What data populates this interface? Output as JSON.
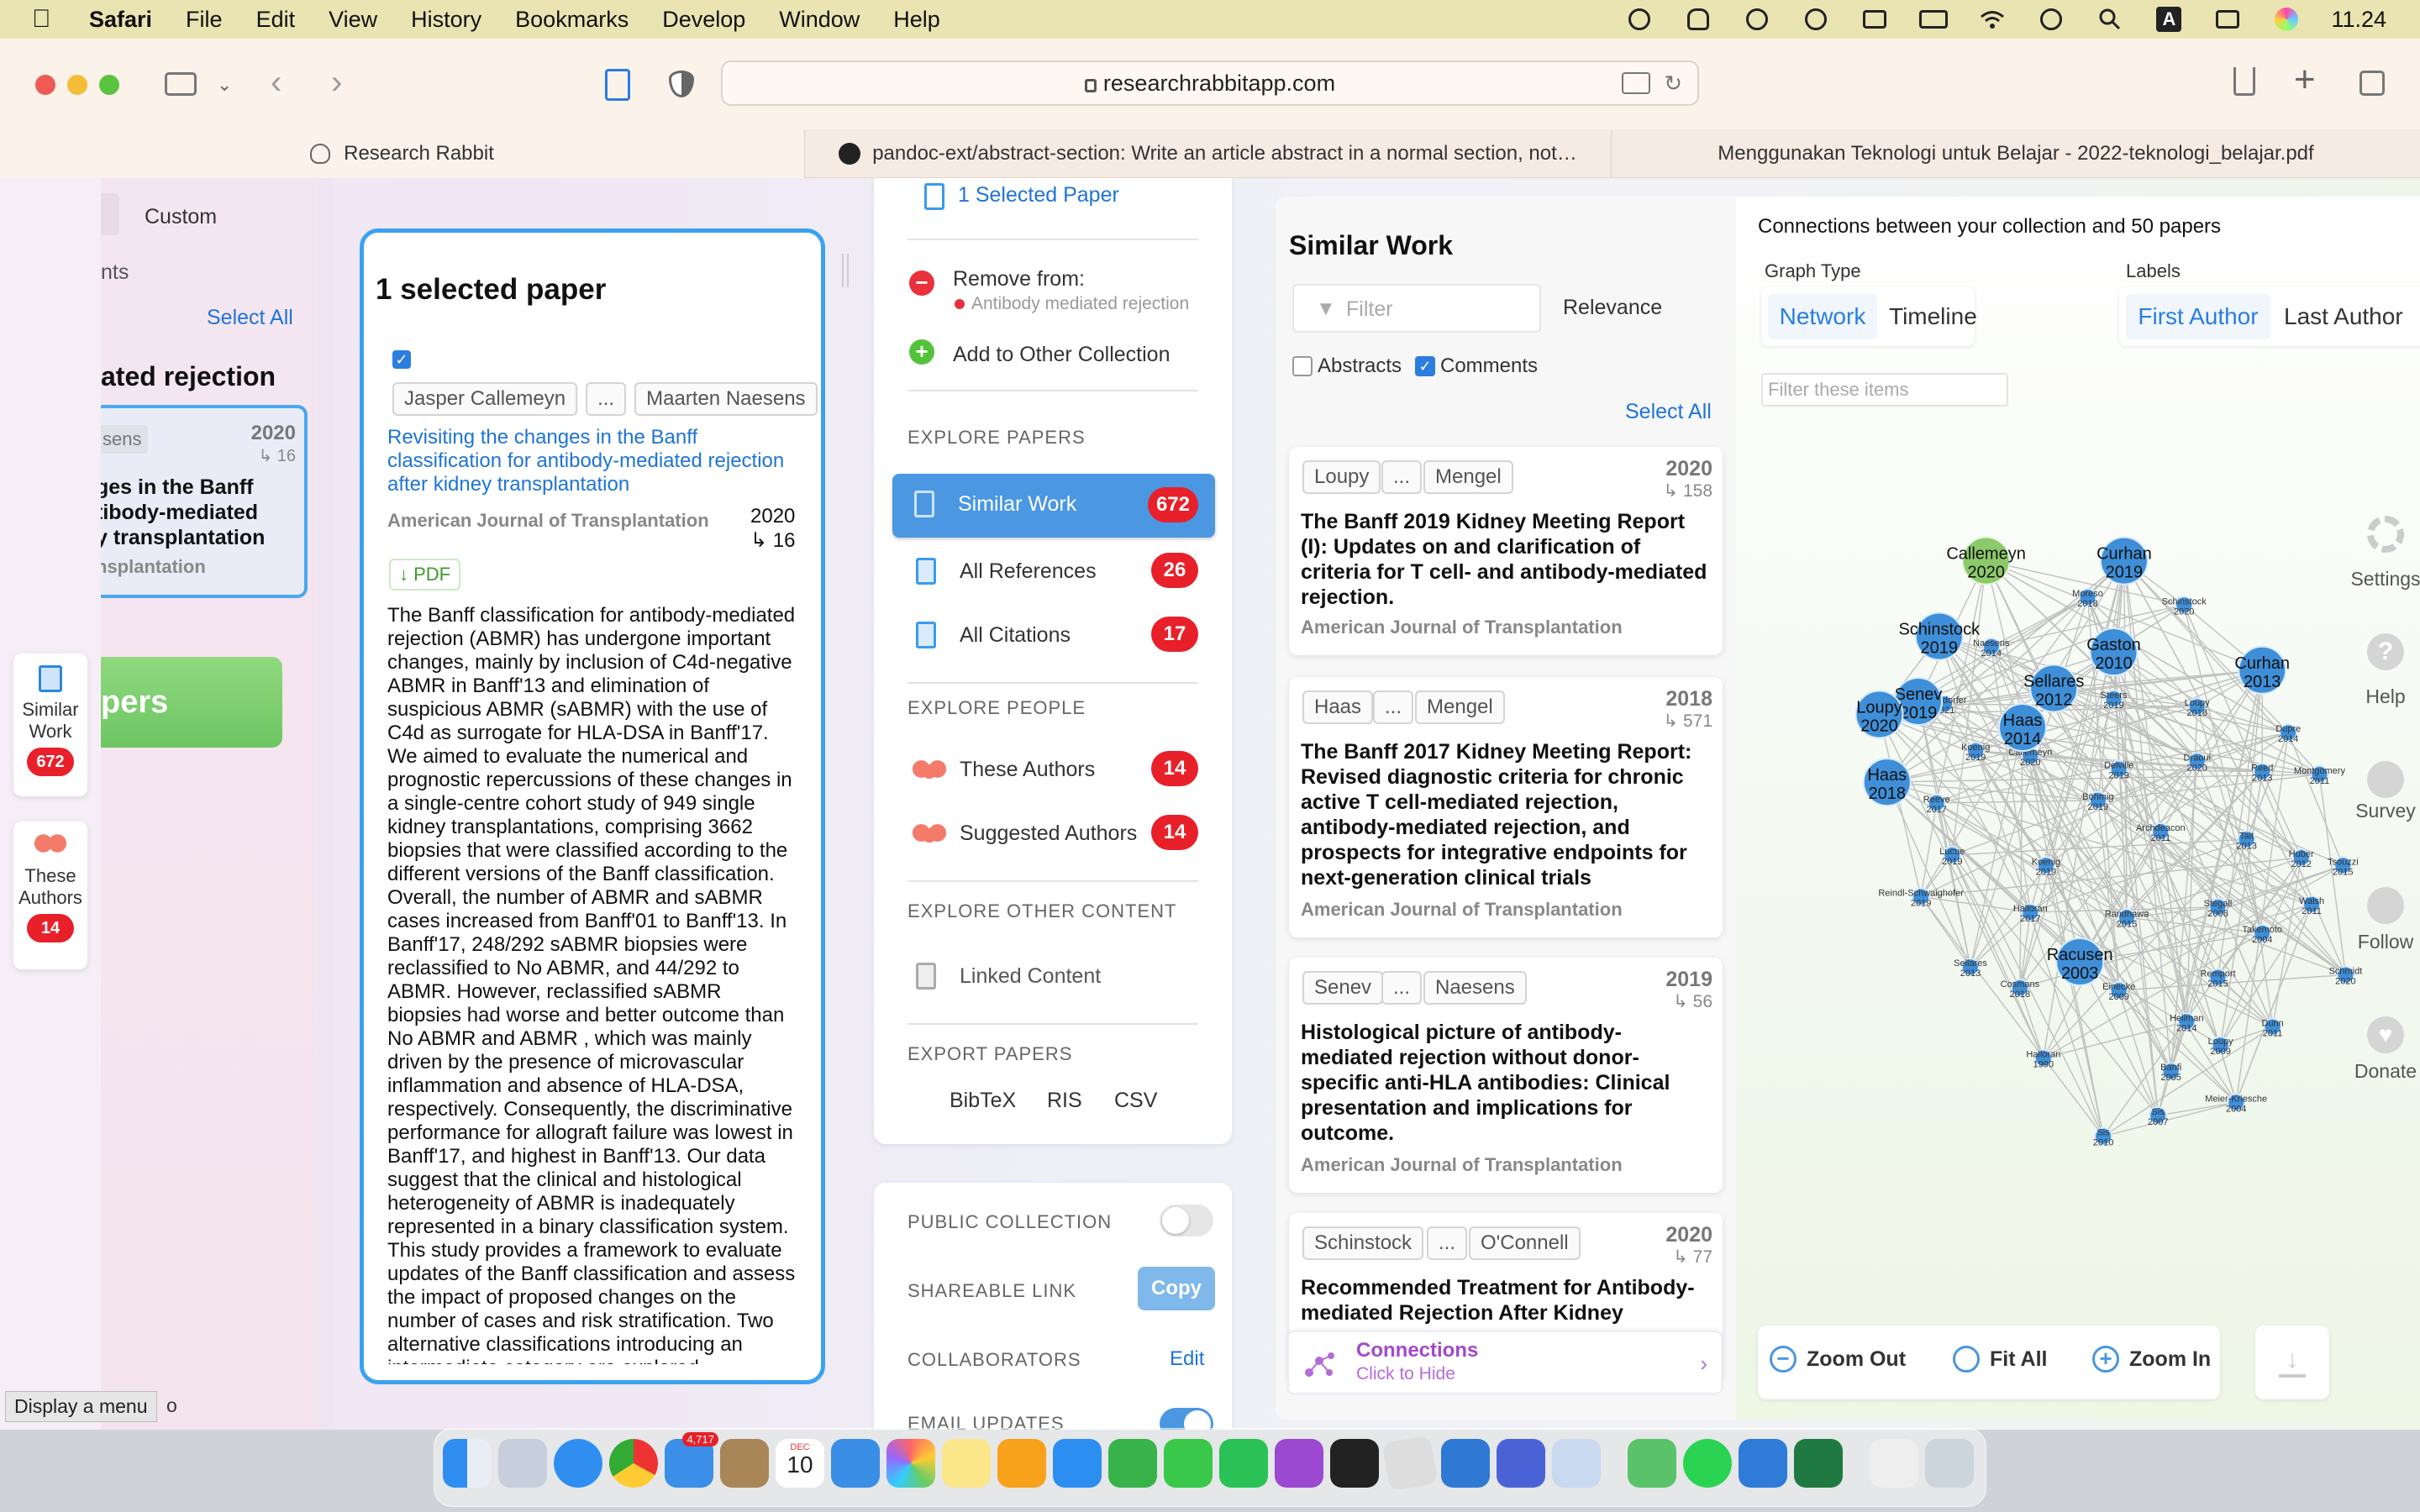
{
  "menubar": {
    "app_name": "Safari",
    "items": [
      "File",
      "Edit",
      "View",
      "History",
      "Bookmarks",
      "Develop",
      "Window",
      "Help"
    ],
    "clock": "11.24",
    "input_source": "A"
  },
  "browser": {
    "url": "researchrabbitapp.com",
    "tabs": [
      {
        "label": "Research Rabbit"
      },
      {
        "label": "pandoc-ext/abstract-section: Write an article abstract in a normal section, not…"
      },
      {
        "label": "Menggunakan Teknologi untuk Belajar - 2022-teknologi_belajar.pdf"
      }
    ]
  },
  "left_panel": {
    "custom_label": "Custom",
    "partial_text": "nts",
    "select_all": "Select All",
    "collection_title": "ated rejection",
    "paper_author": "sens",
    "paper_year": "2020",
    "paper_cites": "↳ 16",
    "paper_title_l1": "ges in the Banff",
    "paper_title_l2": "tibody-mediated",
    "paper_title_l3": "y transplantation",
    "paper_journal": "nsplantation",
    "green_button": "pers",
    "tooltip": "Display a menu",
    "tooltip_tail": "o"
  },
  "side_tabs": [
    {
      "label_1": "Similar",
      "label_2": "Work",
      "count": "672"
    },
    {
      "label_1": "These",
      "label_2": "Authors",
      "count": "14"
    }
  ],
  "selected_paper": {
    "heading": "1 selected paper",
    "author_1": "Jasper Callemeyn",
    "ellipsis": "...",
    "author_2": "Maarten Naesens",
    "title": "Revisiting the changes in the Banff classification for antibody-mediated rejection after kidney transplantation",
    "journal": "American Journal of Transplantation",
    "year": "2020",
    "citations": "↳ 16",
    "pdf": "↓ PDF",
    "abstract": "The Banff classification for antibody-mediated rejection (ABMR) has undergone important changes, mainly by inclusion of C4d-negative ABMR in Banff'13 and elimination of suspicious ABMR (sABMR) with the use of C4d as surrogate for HLA-DSA in Banff'17. We aimed to evaluate the numerical and prognostic repercussions of these changes in a single-centre cohort study of 949 single kidney transplantations, comprising 3662 biopsies that were classified according to the different versions of the Banff classification. Overall, the number of ABMR and sABMR cases increased from Banff'01 to Banff'13. In Banff'17, 248/292 sABMR biopsies were reclassified to No ABMR, and 44/292 to ABMR. However, reclassified sABMR biopsies had worse and better outcome than No ABMR and ABMR , which was mainly driven by the presence of microvascular inflammation and absence of HLA-DSA, respectively. Consequently, the discriminative performance for allograft failure was lowest in Banff'17, and highest in Banff'13. Our data suggest that the clinical and histological heterogeneity of ABMR is inadequately represented in a binary classification system. This study provides a framework to evaluate updates of the Banff classification and assess the impact of proposed changes on the number of cases and risk stratification. Two alternative classifications introducing an intermediate category are explored"
  },
  "actions": {
    "selected_count": "1 Selected Paper",
    "remove_from": "Remove from:",
    "remove_collection": "Antibody mediated rejection",
    "add_to_other": "Add to Other Collection",
    "explore_papers": "EXPLORE PAPERS",
    "similar_work": "Similar Work",
    "similar_work_count": "672",
    "all_references": "All References",
    "all_references_count": "26",
    "all_citations": "All Citations",
    "all_citations_count": "17",
    "explore_people": "EXPLORE PEOPLE",
    "these_authors": "These Authors",
    "these_authors_count": "14",
    "suggested_authors": "Suggested Authors",
    "suggested_authors_count": "14",
    "explore_other": "EXPLORE OTHER CONTENT",
    "linked_content": "Linked Content",
    "export_papers": "EXPORT PAPERS",
    "bibtex": "BibTeX",
    "ris": "RIS",
    "csv": "CSV",
    "public_collection": "PUBLIC COLLECTION",
    "shareable_link": "SHAREABLE LINK",
    "copy": "Copy",
    "collaborators": "COLLABORATORS",
    "edit": "Edit",
    "email_updates": "EMAIL UPDATES"
  },
  "similar_work": {
    "title": "Similar Work",
    "filter_placeholder": "Filter",
    "sort": "Relevance",
    "abstracts_label": "Abstracts",
    "comments_label": "Comments",
    "select_all": "Select All",
    "papers": [
      {
        "author_1": "Loupy",
        "author_2": "Mengel",
        "year": "2020",
        "cites": "↳ 158",
        "title": "The Banff 2019 Kidney Meeting Report (I): Updates on and clarification of criteria for T cell- and antibody-mediated rejection.",
        "journal": "American Journal of Transplantation"
      },
      {
        "author_1": "Haas",
        "author_2": "Mengel",
        "year": "2018",
        "cites": "↳ 571",
        "title": "The Banff 2017 Kidney Meeting Report: Revised diagnostic criteria for chronic active T cell-mediated rejection, antibody-mediated rejection, and prospects for integrative endpoints for next-generation clinical trials",
        "journal": "American Journal of Transplantation"
      },
      {
        "author_1": "Senev",
        "author_2": "Naesens",
        "year": "2019",
        "cites": "↳ 56",
        "title": "Histological picture of antibody-mediated rejection without donor-specific anti-HLA antibodies: Clinical presentation and implications for outcome.",
        "journal": "American Journal of Transplantation"
      },
      {
        "author_1": "Schinstock",
        "author_2": "O'Connell",
        "year": "2020",
        "cites": "↳ 77",
        "title": "Recommended Treatment for Antibody-mediated Rejection After Kidney",
        "journal": ""
      }
    ],
    "ellipsis": "...",
    "connections_title": "Connections",
    "connections_sub": "Click to Hide"
  },
  "graph": {
    "title": "Connections between your collection and 50 papers",
    "graph_type_label": "Graph Type",
    "network": "Network",
    "timeline": "Timeline",
    "labels_label": "Labels",
    "first_author": "First Author",
    "last_author": "Last Author",
    "filter_placeholder": "Filter these items",
    "zoom_out": "Zoom Out",
    "fit_all": "Fit All",
    "zoom_in": "Zoom In",
    "big_nodes": [
      {
        "name": "Callemeyn",
        "year": "2020"
      },
      {
        "name": "Curhan",
        "year": "2019"
      },
      {
        "name": "Schinstock",
        "year": "2019"
      },
      {
        "name": "Gaston",
        "year": "2010"
      },
      {
        "name": "Curhan",
        "year": "2013"
      },
      {
        "name": "Senev",
        "year": "2019"
      },
      {
        "name": "Loupy",
        "year": "2020"
      },
      {
        "name": "Sellares",
        "year": "2012"
      },
      {
        "name": "Haas",
        "year": "2014"
      },
      {
        "name": "Haas",
        "year": "2018"
      },
      {
        "name": "Racusen",
        "year": "2003"
      }
    ],
    "small_nodes": [
      {
        "name": "Moreso",
        "year": "2018"
      },
      {
        "name": "Schinstock",
        "year": "2020"
      },
      {
        "name": "Naesens",
        "year": "2014"
      },
      {
        "name": "Mayrdorfer",
        "year": "2021"
      },
      {
        "name": "Steers",
        "year": "2019"
      },
      {
        "name": "Loupy",
        "year": "2018"
      },
      {
        "name": "Koenig",
        "year": "2019"
      },
      {
        "name": "Callemeyn",
        "year": "2020"
      },
      {
        "name": "Reeve",
        "year": "2017"
      },
      {
        "name": "Böhmig",
        "year": "2019"
      },
      {
        "name": "Delville",
        "year": "2019"
      },
      {
        "name": "Draoui",
        "year": "2020"
      },
      {
        "name": "Reed",
        "year": "2013"
      },
      {
        "name": "Montgomery",
        "year": "2011"
      },
      {
        "name": "Dupre",
        "year": "2014"
      },
      {
        "name": "Archdeacon",
        "year": "2011"
      },
      {
        "name": "Tait",
        "year": "2013"
      },
      {
        "name": "Huber",
        "year": "2012"
      },
      {
        "name": "Tsouzzi",
        "year": "2015"
      },
      {
        "name": "Lucue",
        "year": "2019"
      },
      {
        "name": "Koenig",
        "year": "2019"
      },
      {
        "name": "Reindl-Schwaighofer",
        "year": "2019"
      },
      {
        "name": "Halloran",
        "year": "2017"
      },
      {
        "name": "Randhawa",
        "year": "2015"
      },
      {
        "name": "Stegall",
        "year": "2006"
      },
      {
        "name": "Takemoto",
        "year": "2004"
      },
      {
        "name": "Walsh",
        "year": "2011"
      },
      {
        "name": "Sellares",
        "year": "2013"
      },
      {
        "name": "Cosmans",
        "year": "2018"
      },
      {
        "name": "Einecke",
        "year": "2009"
      },
      {
        "name": "Remport",
        "year": "2015"
      },
      {
        "name": "Schmidt",
        "year": "2020"
      },
      {
        "name": "Heilman",
        "year": "2014"
      },
      {
        "name": "Loupy",
        "year": "2009"
      },
      {
        "name": "Dunn",
        "year": "2011"
      },
      {
        "name": "Halloran",
        "year": "1990"
      },
      {
        "name": "Banfi",
        "year": "2005"
      },
      {
        "name": "Meier-Kriesche",
        "year": "2004"
      },
      {
        "name": "Sis",
        "year": "2010"
      },
      {
        "name": "Sis",
        "year": "2007"
      }
    ]
  },
  "right_nav": {
    "settings": "Settings",
    "help": "Help",
    "survey": "Survey",
    "follow": "Follow",
    "donate": "Donate"
  },
  "dock": {
    "mail_badge": "4,717",
    "calendar_month": "DEC",
    "calendar_day": "10"
  }
}
